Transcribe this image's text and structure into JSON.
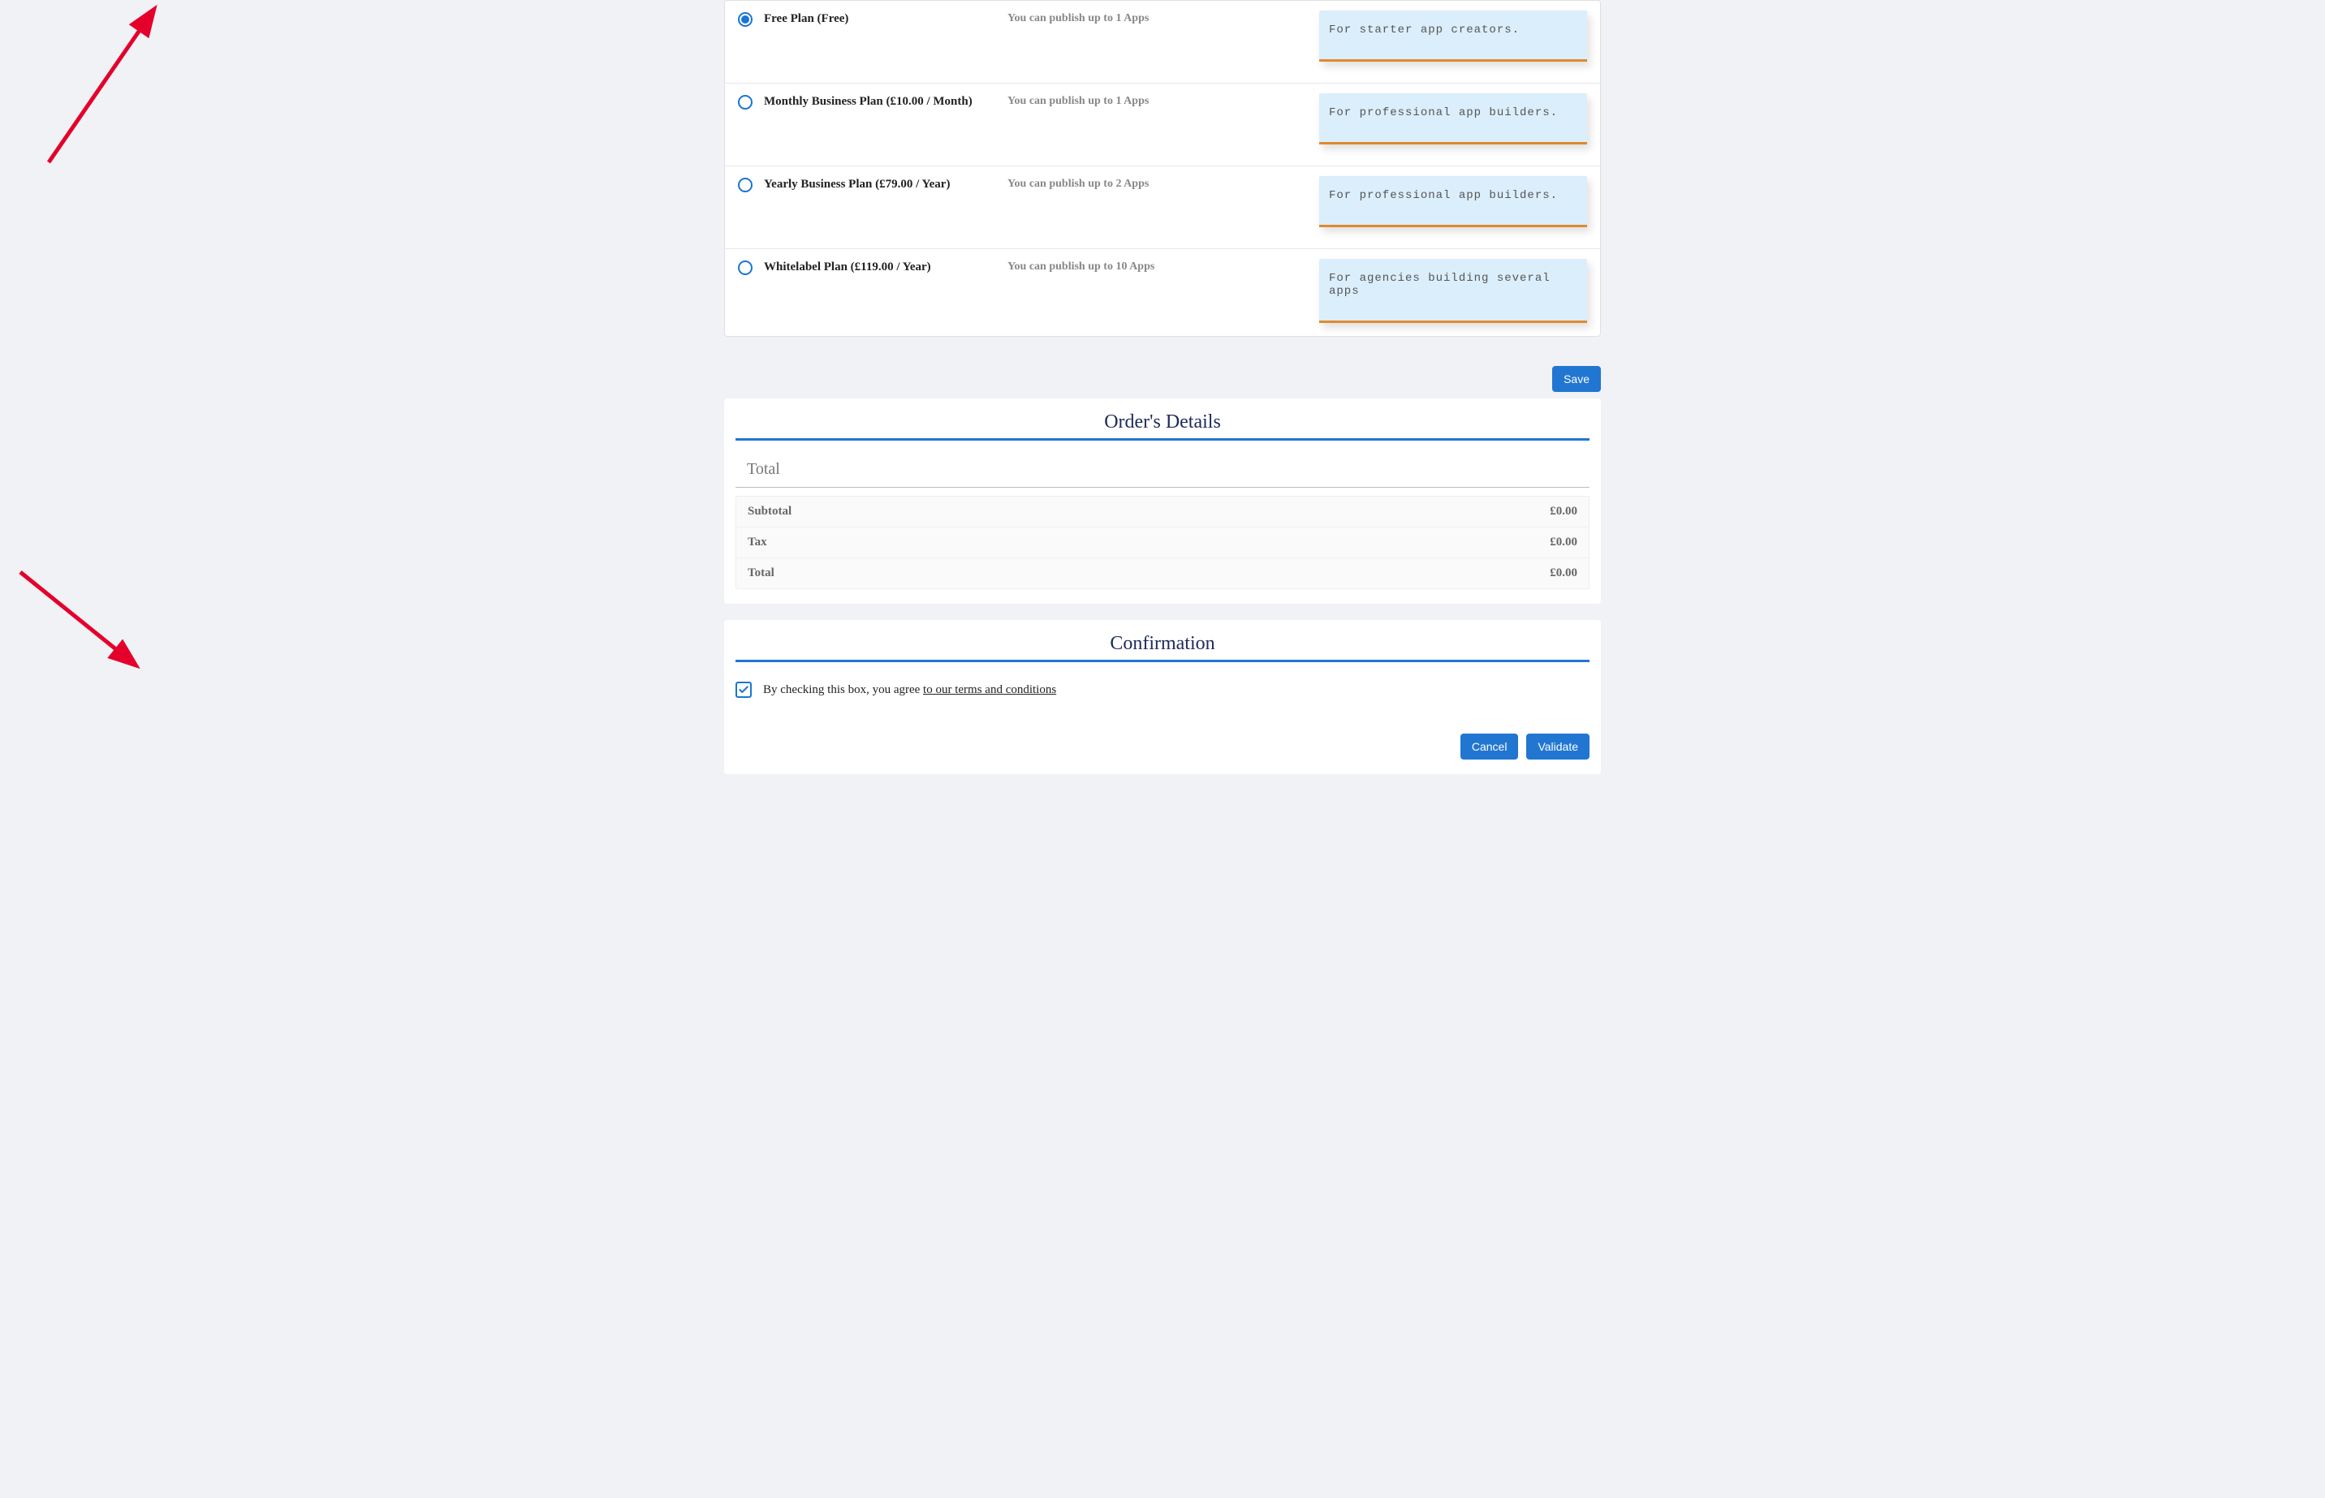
{
  "plans": [
    {
      "name": "Free Plan (Free)",
      "desc": "You can publish up to 1 Apps",
      "note": "For starter app creators.",
      "selected": true
    },
    {
      "name": "Monthly Business Plan (£10.00 / Month)",
      "desc": "You can publish up to 1 Apps",
      "note": "For professional app builders.",
      "selected": false
    },
    {
      "name": "Yearly Business Plan (£79.00 / Year)",
      "desc": "You can publish up to 2 Apps",
      "note": "For professional app builders.",
      "selected": false
    },
    {
      "name": "Whitelabel Plan (£119.00 / Year)",
      "desc": "You can publish up to 10 Apps",
      "note": "For agencies building several apps",
      "selected": false
    }
  ],
  "save_label": "Save",
  "order": {
    "title": "Order's Details",
    "total_heading": "Total",
    "rows": [
      {
        "label": "Subtotal",
        "value": "£0.00"
      },
      {
        "label": "Tax",
        "value": "£0.00"
      },
      {
        "label": "Total",
        "value": "£0.00"
      }
    ]
  },
  "confirmation": {
    "title": "Confirmation",
    "checked": true,
    "text_prefix": "By checking this box, you agree ",
    "link_text": "to our terms and conditions"
  },
  "actions": {
    "cancel": "Cancel",
    "validate": "Validate"
  }
}
